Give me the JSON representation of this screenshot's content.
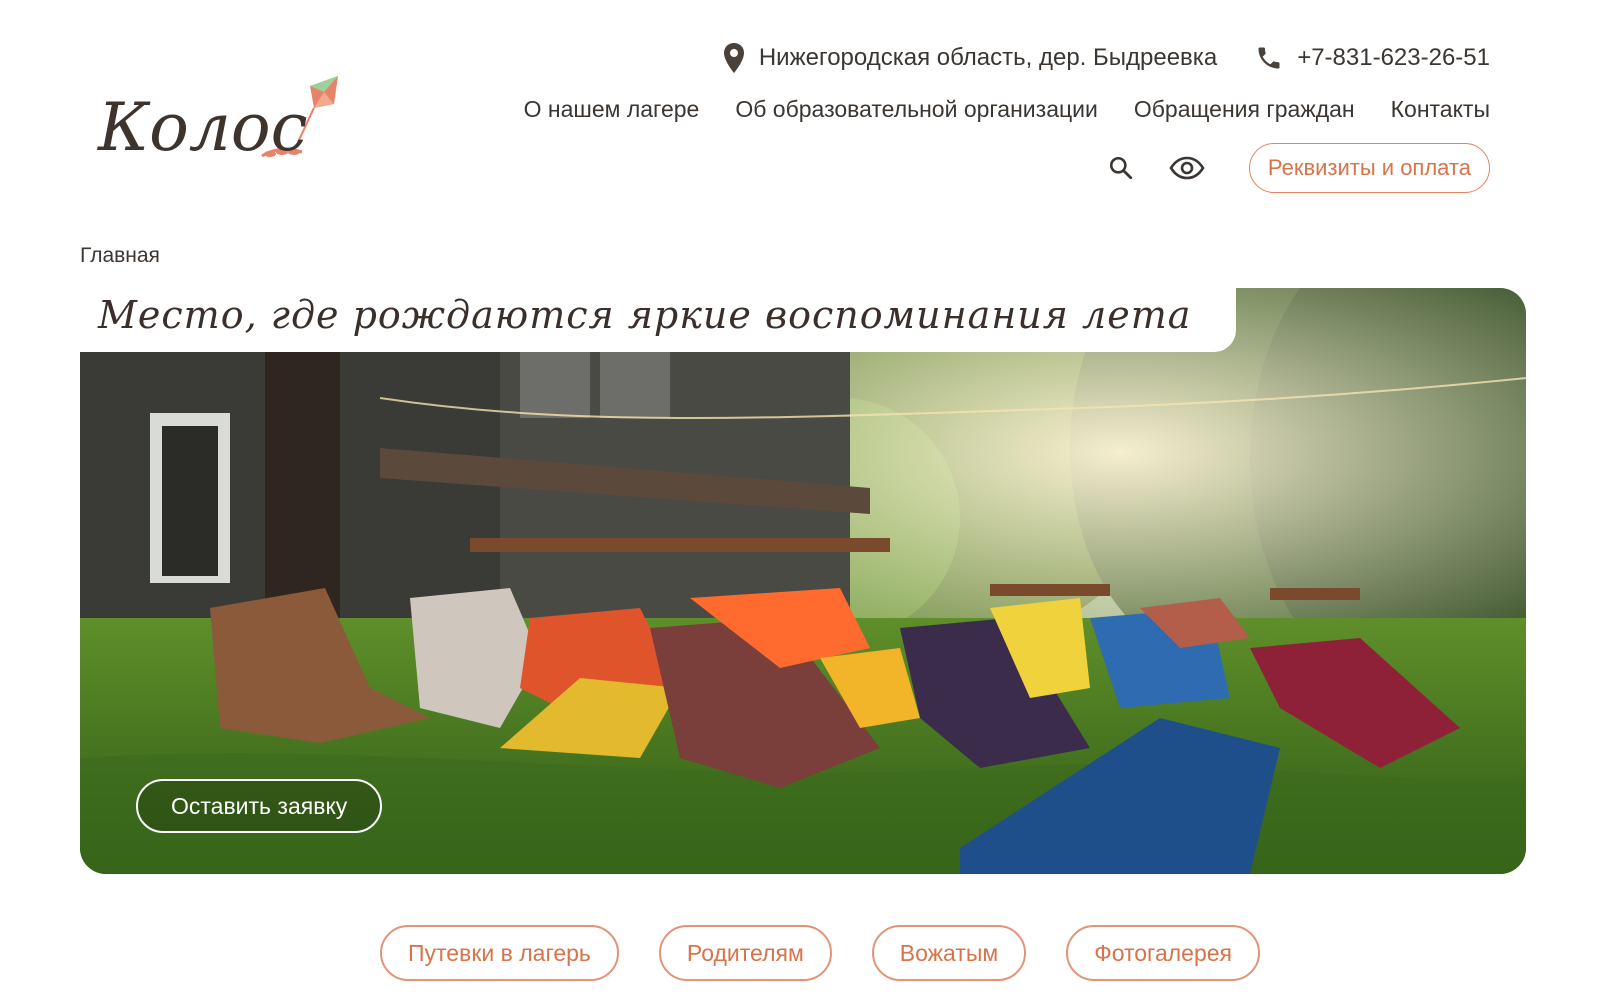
{
  "brand": {
    "logo_text": "Колос",
    "accent_color": "#d8734a",
    "text_color": "#3b3632"
  },
  "header": {
    "address": {
      "icon": "location-pin-icon",
      "text": "Нижегородская область, дер. Быдреевка"
    },
    "phone": {
      "icon": "phone-icon",
      "text": "+7-831-623-26-51"
    },
    "nav": [
      {
        "label": "О нашем лагере"
      },
      {
        "label": "Об образовательной организации"
      },
      {
        "label": "Обращения граждан"
      },
      {
        "label": "Контакты"
      }
    ],
    "tools": {
      "search_icon": "search-icon",
      "accessibility_icon": "eye-icon",
      "requisites_label": "Реквизиты и оплата"
    }
  },
  "breadcrumb": {
    "current": "Главная"
  },
  "hero": {
    "slogan": "Место, где рождаются яркие воспоминания лета",
    "request_button": "Оставить заявку"
  },
  "quick_links": [
    {
      "label": "Путевки в лагерь"
    },
    {
      "label": "Родителям"
    },
    {
      "label": "Вожатым"
    },
    {
      "label": "Фотогалерея"
    }
  ]
}
